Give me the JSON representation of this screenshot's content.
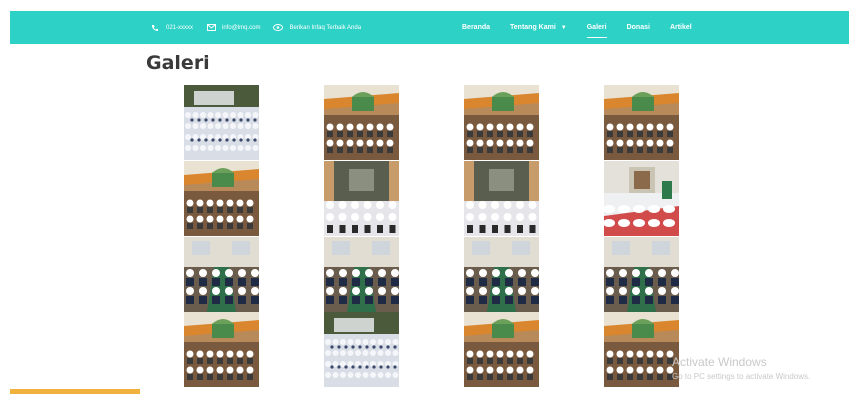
{
  "topbar": {
    "contacts": [
      {
        "icon": "phone-icon",
        "text": "021-xxxxx"
      },
      {
        "icon": "mail-icon",
        "text": "info@lmq.com"
      },
      {
        "icon": "donate-hand-icon",
        "text": "Berikan Infaq Terbaik Anda"
      }
    ],
    "nav": [
      {
        "label": "Beranda",
        "active": false
      },
      {
        "label": "Tentang Kami",
        "active": false,
        "dropdown": true
      },
      {
        "label": "Galeri",
        "active": true
      },
      {
        "label": "Donasi",
        "active": false
      },
      {
        "label": "Artikel",
        "active": false
      }
    ],
    "color": "#2dd1c6"
  },
  "page": {
    "title": "Galeri"
  },
  "gallery": {
    "photos": [
      {
        "scene": "outdoor-crowd"
      },
      {
        "scene": "classroom-window"
      },
      {
        "scene": "classroom-window"
      },
      {
        "scene": "classroom-window"
      },
      {
        "scene": "classroom-window"
      },
      {
        "scene": "group-portrait"
      },
      {
        "scene": "group-portrait"
      },
      {
        "scene": "prayer-hall"
      },
      {
        "scene": "seated-study"
      },
      {
        "scene": "seated-study"
      },
      {
        "scene": "seated-study"
      },
      {
        "scene": "seated-study"
      },
      {
        "scene": "classroom-window"
      },
      {
        "scene": "outdoor-crowd"
      },
      {
        "scene": "classroom-window"
      },
      {
        "scene": "classroom-window"
      }
    ]
  },
  "watermark": {
    "line1": "Activate Windows",
    "line2": "Go to PC settings to activate Windows."
  }
}
